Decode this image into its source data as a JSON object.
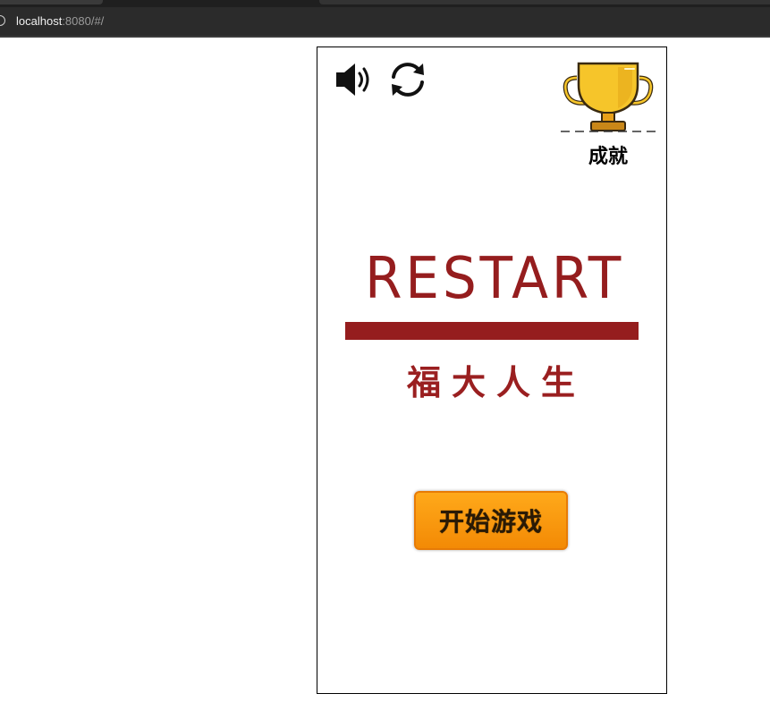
{
  "browser": {
    "url_host": "localhost",
    "url_rest": ":8080/#/"
  },
  "game": {
    "icons": {
      "sound": "speaker-icon",
      "refresh": "refresh-icon",
      "achievements": "trophy-icon"
    },
    "achievements_label": "成就",
    "logo_text": "RESTART",
    "subtitle": "福大人生",
    "start_button_label": "开始游戏",
    "colors": {
      "brand_red": "#951d1e",
      "button_orange": "#f7931b",
      "trophy_gold": "#f6c52a"
    }
  }
}
